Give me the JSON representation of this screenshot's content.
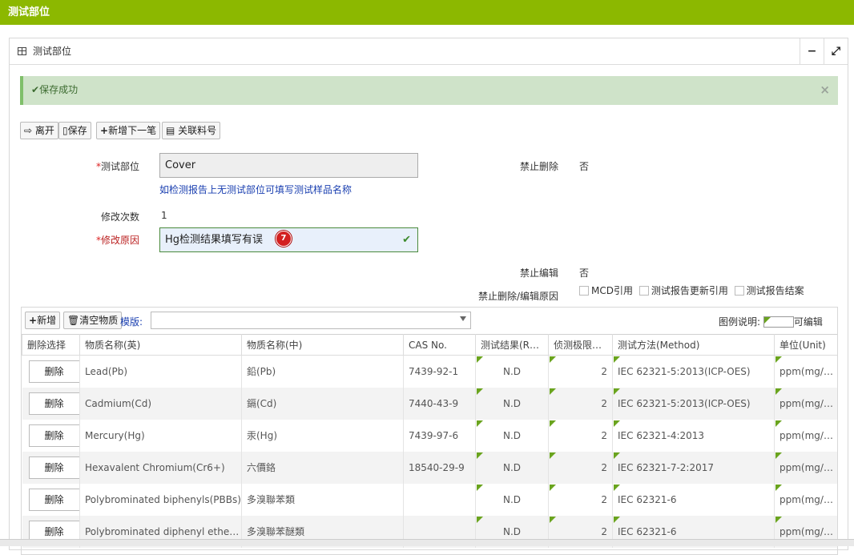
{
  "window": {
    "title": "测试部位"
  },
  "panel": {
    "title": "测试部位",
    "minimize": "−",
    "expand": "⤢"
  },
  "alert": {
    "message": "保存成功",
    "close": "×"
  },
  "toolbar": {
    "leave": "离开",
    "save": "保存",
    "add_next": "新增下一笔",
    "link_material": "关联料号"
  },
  "form": {
    "test_part_label": "测试部位",
    "test_part_value": "Cover",
    "test_part_hint": "如检测报告上无测试部位可填写测试样品名称",
    "no_delete_label": "禁止删除",
    "no_delete_value": "否",
    "modify_count_label": "修改次数",
    "modify_count_value": "1",
    "modify_reason_label": "修改原因",
    "modify_reason_value": "Hg检测结果填写有误",
    "badge": "7",
    "no_edit_label": "禁止编辑",
    "no_edit_value": "否",
    "reason_label": "禁止删除/编辑原因",
    "checks": [
      "MCD引用",
      "测试报告更新引用",
      "测试报告结案"
    ]
  },
  "grid": {
    "add": "新增",
    "clear": "清空物质",
    "template_label": "模版:",
    "legend_label": "图例说明:",
    "legend_text": "可编辑",
    "columns": [
      "删除选择",
      "物质名称(英)",
      "物质名称(中)",
      "CAS No.",
      "测试结果(R…",
      "侦测极限…",
      "测试方法(Method)",
      "单位(Unit)"
    ],
    "delete_label": "删除",
    "rows": [
      {
        "en": "Lead(Pb)",
        "cn": "鉛(Pb)",
        "cas": "7439-92-1",
        "result": "N.D",
        "limit": "2",
        "method": "IEC 62321-5:2013(ICP-OES)",
        "unit": "ppm(mg/kg)"
      },
      {
        "en": "Cadmium(Cd)",
        "cn": "鎘(Cd)",
        "cas": "7440-43-9",
        "result": "N.D",
        "limit": "2",
        "method": "IEC 62321-5:2013(ICP-OES)",
        "unit": "ppm(mg/kg)"
      },
      {
        "en": "Mercury(Hg)",
        "cn": "汞(Hg)",
        "cas": "7439-97-6",
        "result": "N.D",
        "limit": "2",
        "method": "IEC 62321-4:2013",
        "unit": "ppm(mg/kg)"
      },
      {
        "en": "Hexavalent Chromium(Cr6+)",
        "cn": "六價鉻",
        "cas": "18540-29-9",
        "result": "N.D",
        "limit": "2",
        "method": "IEC 62321-7-2:2017",
        "unit": "ppm(mg/kg)"
      },
      {
        "en": "Polybrominated biphenyls(PBBs)",
        "cn": "多溴聯苯類",
        "cas": "",
        "result": "N.D",
        "limit": "2",
        "method": "IEC 62321-6",
        "unit": "ppm(mg/kg)"
      },
      {
        "en": "Polybrominated diphenyl ethers(…",
        "cn": "多溴聯苯醚類",
        "cas": "",
        "result": "N.D",
        "limit": "2",
        "method": "IEC 62321-6",
        "unit": "ppm(mg/kg)"
      }
    ]
  }
}
